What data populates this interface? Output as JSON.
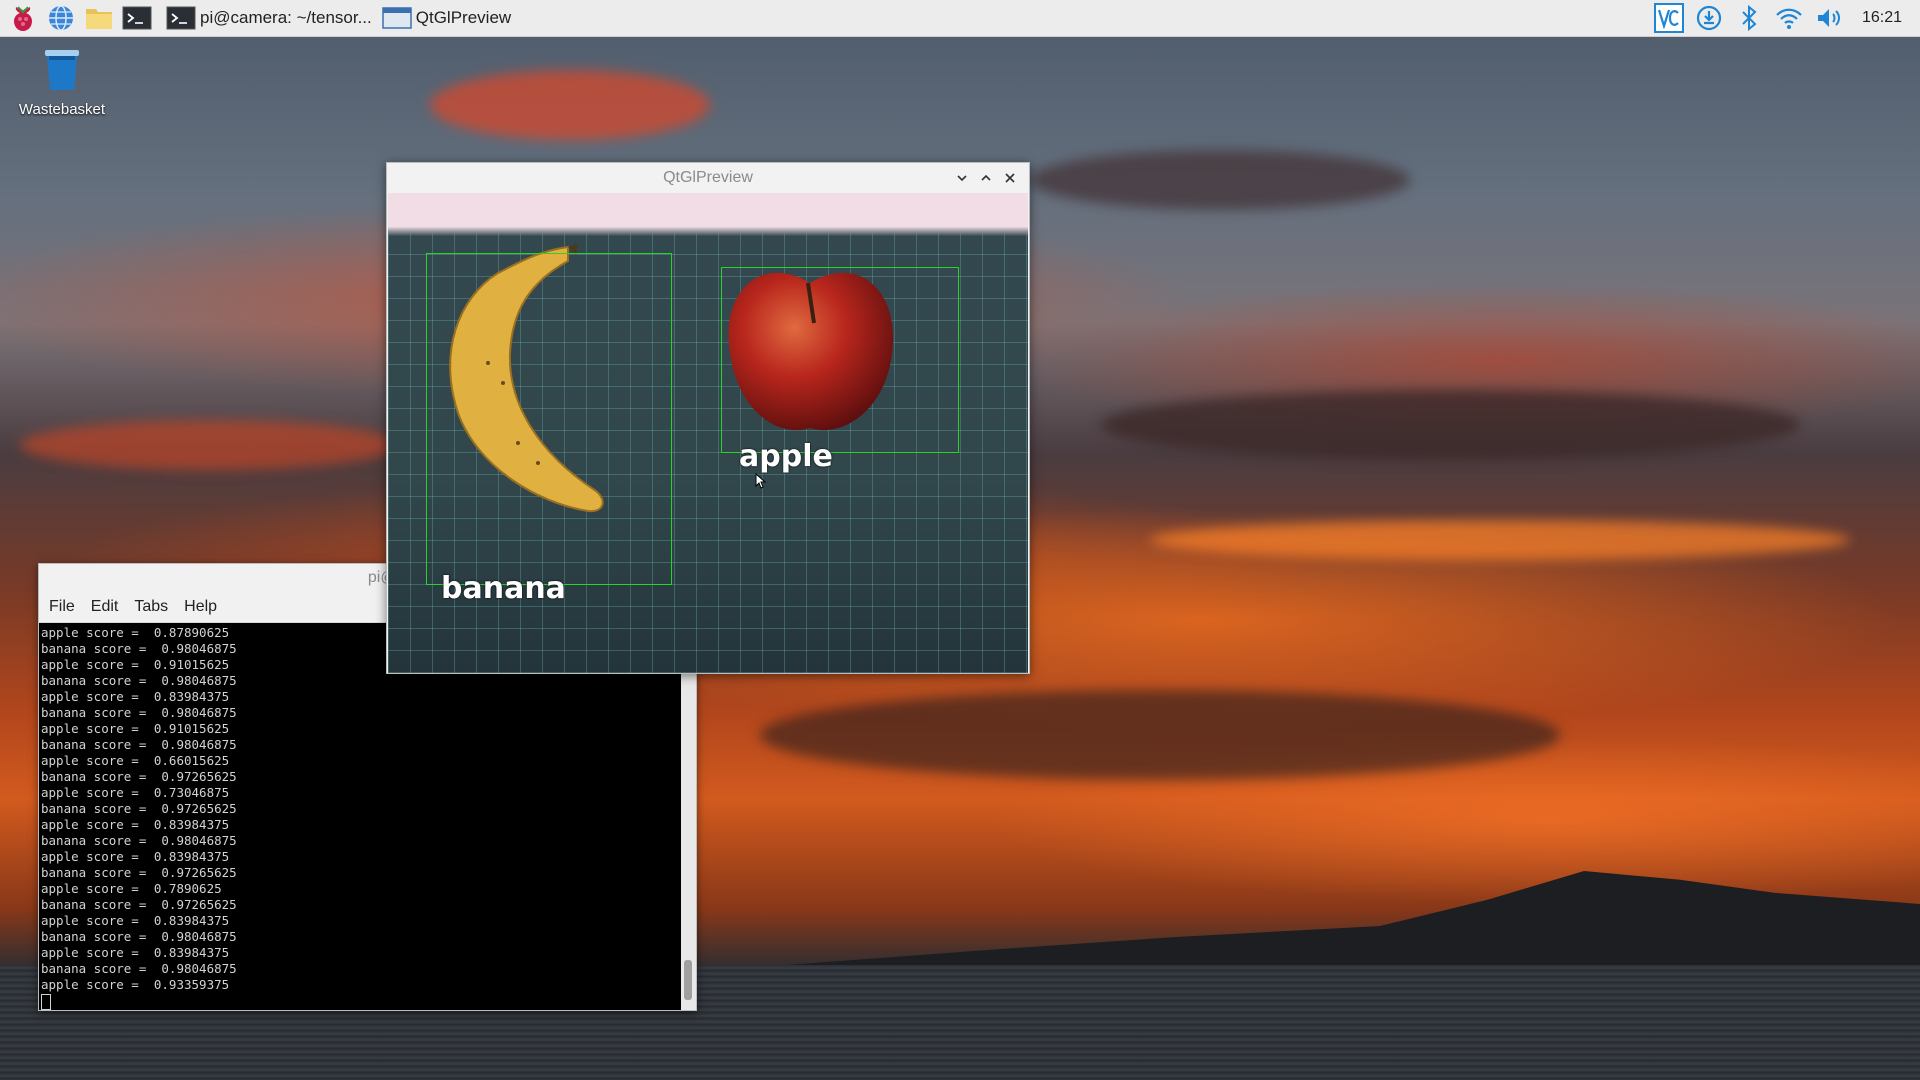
{
  "taskbar": {
    "raspberry_icon": "raspberry-menu-icon",
    "browser_icon": "globe-icon",
    "files_icon": "folder-icon",
    "terminal_icon": "terminal-icon",
    "task_terminal": "pi@camera: ~/tensor...",
    "task_preview": "QtGlPreview",
    "tray": {
      "vnc_icon": "vnc-icon",
      "update_icon": "download-icon",
      "bluetooth_icon": "bluetooth-icon",
      "wifi_icon": "wifi-icon",
      "volume_icon": "volume-icon",
      "clock": "16:21"
    }
  },
  "desktop": {
    "wastebasket_label": "Wastebasket"
  },
  "preview_window": {
    "title": "QtGlPreview",
    "detections": [
      {
        "label": "banana"
      },
      {
        "label": "apple"
      }
    ]
  },
  "terminal_window": {
    "title": "pi@camera: ~/t",
    "menu": [
      "File",
      "Edit",
      "Tabs",
      "Help"
    ],
    "lines": [
      "apple score =  0.87890625",
      "banana score =  0.98046875",
      "apple score =  0.91015625",
      "banana score =  0.98046875",
      "apple score =  0.83984375",
      "banana score =  0.98046875",
      "apple score =  0.91015625",
      "banana score =  0.98046875",
      "apple score =  0.66015625",
      "banana score =  0.97265625",
      "apple score =  0.73046875",
      "banana score =  0.97265625",
      "apple score =  0.83984375",
      "banana score =  0.98046875",
      "apple score =  0.83984375",
      "banana score =  0.97265625",
      "apple score =  0.7890625",
      "banana score =  0.97265625",
      "apple score =  0.83984375",
      "banana score =  0.98046875",
      "apple score =  0.83984375",
      "banana score =  0.98046875",
      "apple score =  0.93359375"
    ]
  },
  "colors": {
    "bbox": "#2ad12a",
    "taskbar_bg": "#ececec",
    "tray_accent": "#1f86d6"
  }
}
